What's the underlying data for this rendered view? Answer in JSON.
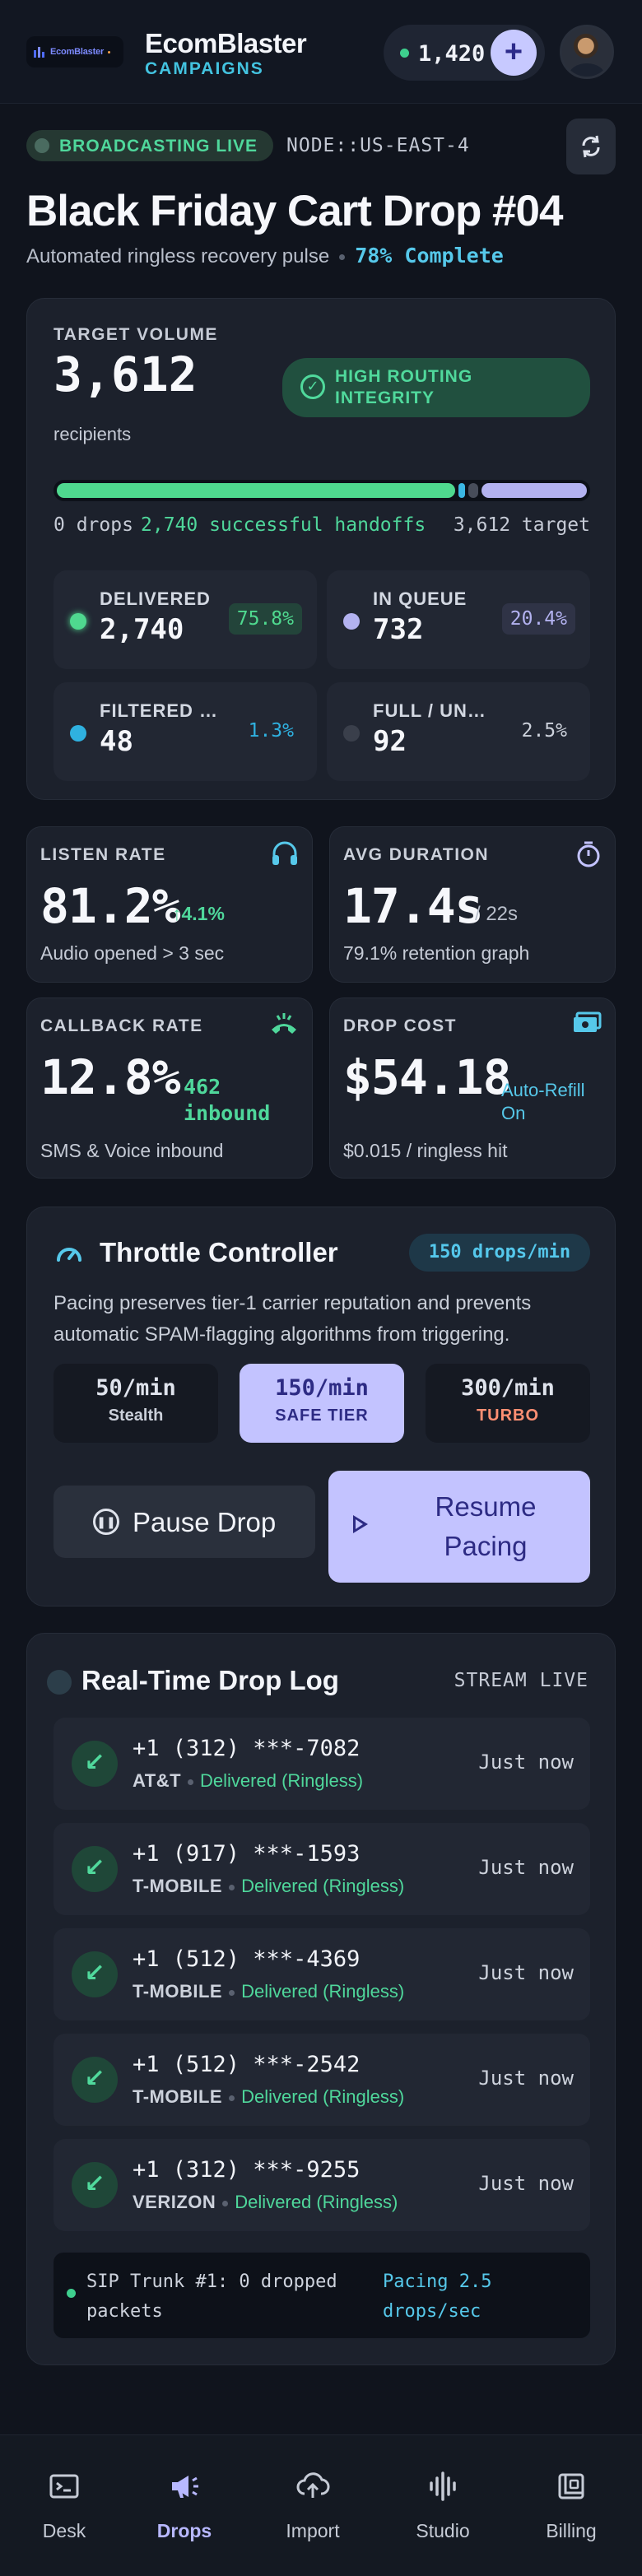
{
  "header": {
    "logo_text": "EcomBlaster",
    "title": "EcomBlaster",
    "subtitle": "CAMPAIGNS",
    "credits": "1,420",
    "add_label": "+"
  },
  "status": {
    "live_label": "BROADCASTING LIVE",
    "node": "NODE::US-EAST-4",
    "refresh_icon": "refresh-icon"
  },
  "campaign": {
    "title": "Black Friday Cart Drop #04",
    "description": "Automated ringless recovery pulse",
    "completion": "78% Complete"
  },
  "target": {
    "label": "TARGET VOLUME",
    "value": "3,612",
    "unit": "recipients",
    "badge": "HIGH ROUTING INTEGRITY",
    "progress": {
      "delivered_fraction": 0.758,
      "filtered_fraction": 0.013,
      "unavailable_fraction": 0.025,
      "queue_fraction": 0.204
    },
    "bar_left": "0 drops",
    "bar_mid": "2,740 successful handoffs",
    "bar_right": "3,612 target"
  },
  "stats": [
    {
      "label": "DELIVERED",
      "value": "2,740",
      "pct": "75.8%",
      "color": "#4fd98f"
    },
    {
      "label": "IN QUEUE",
      "value": "732",
      "pct": "20.4%",
      "color": "#b3b2f0"
    },
    {
      "label": "FILTERED / B...",
      "value": "48",
      "pct": "1.3%",
      "color": "#2fb1e0"
    },
    {
      "label": "FULL / UNAV...",
      "value": "92",
      "pct": "2.5%",
      "color": "#3a3f4b"
    }
  ],
  "metrics": {
    "listen": {
      "label": "LISTEN RATE",
      "value": "81.2%",
      "delta": "↑4.1%",
      "foot": "Audio opened > 3 sec",
      "icon": "headphones-icon"
    },
    "duration": {
      "label": "AVG DURATION",
      "value": "17.4s",
      "suffix": "/ 22s",
      "foot": "79.1% retention graph",
      "icon": "timer-icon"
    },
    "callback": {
      "label": "CALLBACK RATE",
      "value": "12.8%",
      "extra": "462 inbound",
      "foot": "SMS & Voice inbound",
      "icon": "phone-callback-icon"
    },
    "cost": {
      "label": "DROP COST",
      "value": "$54.18",
      "extra": "Auto-Refill On",
      "foot": "$0.015 / ringless hit",
      "icon": "cash-icon"
    }
  },
  "throttle": {
    "title": "Throttle Controller",
    "rate_pill": "150 drops/min",
    "description": "Pacing preserves tier-1 carrier reputation and prevents automatic SPAM-flagging algorithms from triggering.",
    "tiers": [
      {
        "rate": "50/min",
        "name": "Stealth"
      },
      {
        "rate": "150/min",
        "name": "SAFE TIER"
      },
      {
        "rate": "300/min",
        "name": "TURBO"
      }
    ],
    "pause_label": "Pause Drop",
    "resume_label": "Resume Pacing"
  },
  "log": {
    "title": "Real-Time Drop Log",
    "stream_label": "STREAM LIVE",
    "rows": [
      {
        "phone": "+1 (312) ***-7082",
        "carrier": "AT&T",
        "status": "Delivered (Ringless)",
        "time": "Just now"
      },
      {
        "phone": "+1 (917) ***-1593",
        "carrier": "T-MOBILE",
        "status": "Delivered (Ringless)",
        "time": "Just now"
      },
      {
        "phone": "+1 (512) ***-4369",
        "carrier": "T-MOBILE",
        "status": "Delivered (Ringless)",
        "time": "Just now"
      },
      {
        "phone": "+1 (512) ***-2542",
        "carrier": "T-MOBILE",
        "status": "Delivered (Ringless)",
        "time": "Just now"
      },
      {
        "phone": "+1 (312) ***-9255",
        "carrier": "VERIZON",
        "status": "Delivered (Ringless)",
        "time": "Just now"
      }
    ],
    "sip_status": "SIP Trunk #1: 0 dropped packets",
    "sip_rate": "Pacing 2.5 drops/sec"
  },
  "nav": [
    {
      "label": "Desk",
      "icon": "terminal-icon"
    },
    {
      "label": "Drops",
      "icon": "megaphone-icon"
    },
    {
      "label": "Import",
      "icon": "cloud-upload-icon"
    },
    {
      "label": "Studio",
      "icon": "waveform-icon"
    },
    {
      "label": "Billing",
      "icon": "receipt-icon"
    }
  ],
  "colors": {
    "accent": "#c3c3ff",
    "success": "#4fd79b",
    "info": "#56c8ea",
    "background": "#10141d"
  }
}
